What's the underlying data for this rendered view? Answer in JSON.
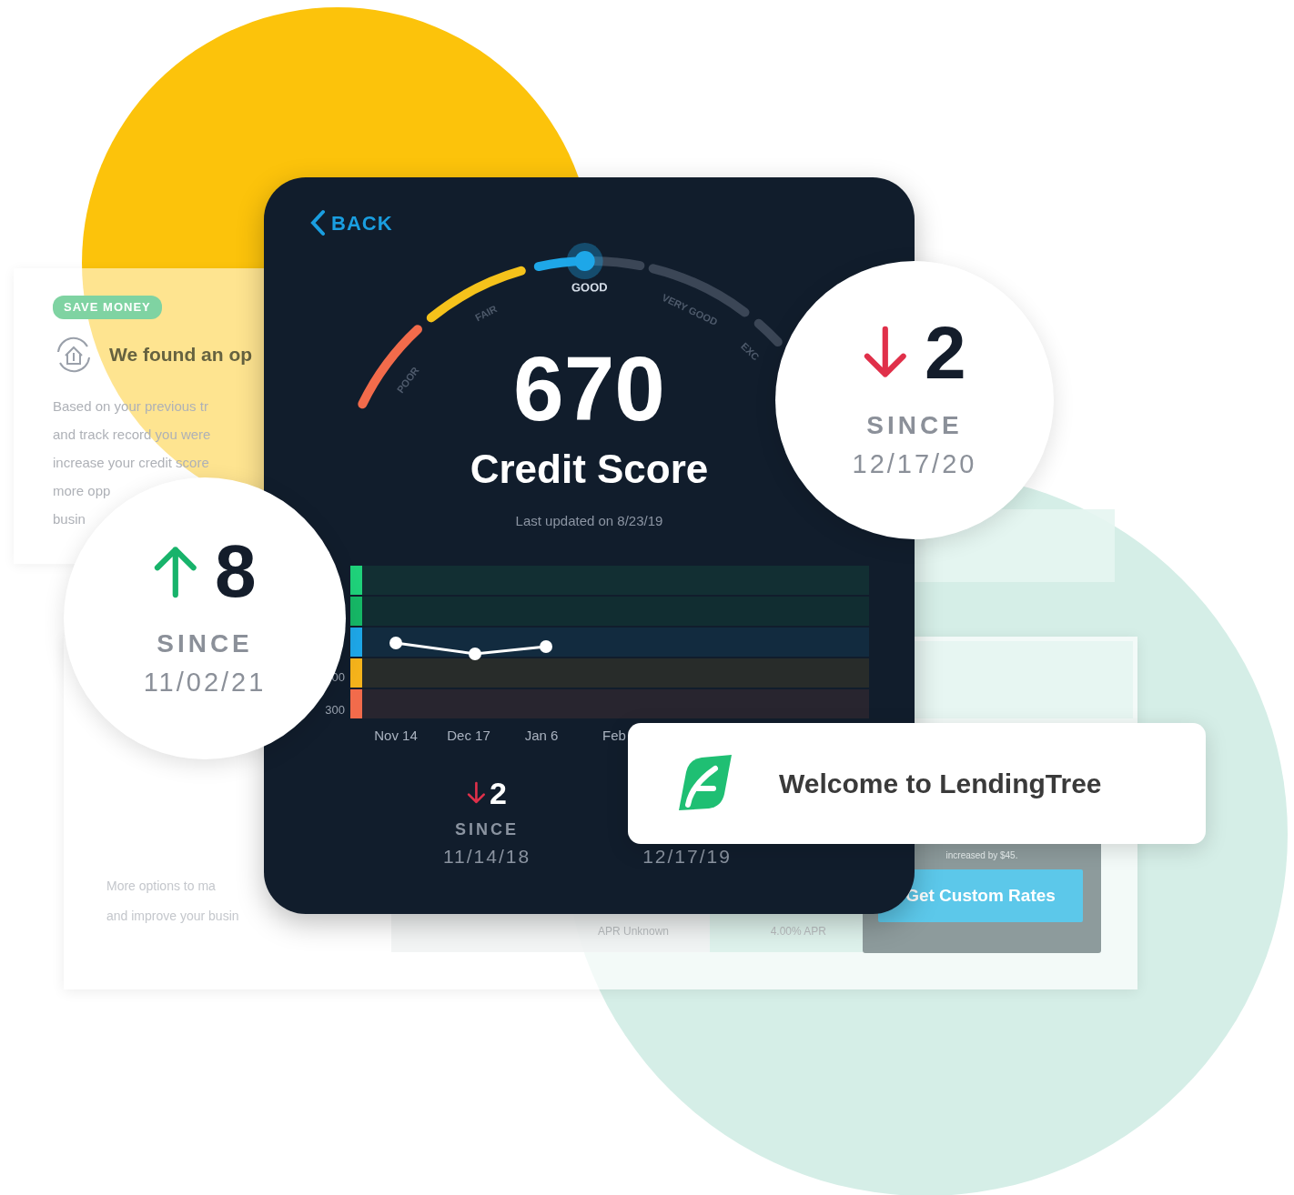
{
  "offer_card": {
    "badge": "SAVE MONEY",
    "title": "We found an op",
    "body": "Based on your previous tr\nand track record you were\nincrease your credit score\nmore opp\nbusin"
  },
  "rates_card": {
    "body": "More options to ma\nand improve your busin",
    "apr_labels": [
      "APR Unknown",
      "4.00% APR"
    ],
    "note": "increased by $45.",
    "button": "Get Custom Rates"
  },
  "score_card": {
    "back": "BACK",
    "gauge": [
      {
        "label": "POOR",
        "color": "#f26b4b",
        "selected": false
      },
      {
        "label": "FAIR",
        "color": "#f5c21b",
        "selected": false
      },
      {
        "label": "GOOD",
        "color": "#1ea7e8",
        "selected": true
      },
      {
        "label": "VERY GOOD",
        "color": "#3b4656",
        "selected": false
      },
      {
        "label": "EXC",
        "color": "#3b4656",
        "selected": false
      }
    ],
    "score": "670",
    "title": "Credit Score",
    "updated": "Last updated on 8/23/19",
    "chart": {
      "y_labels": [
        "00",
        "300"
      ],
      "x_labels": [
        "Nov 14",
        "Dec 17",
        "Jan 6",
        "Feb"
      ],
      "bands": [
        {
          "color": "#1fd17a"
        },
        {
          "color": "#16b866"
        },
        {
          "color": "#1ea7e8"
        },
        {
          "color": "#f5b31b"
        },
        {
          "color": "#f26b4b"
        }
      ]
    },
    "changes": [
      {
        "kind": "decrease",
        "value": "2",
        "since": "SINCE",
        "date": "11/14/18"
      },
      {
        "date": "12/17/19"
      }
    ]
  },
  "bubbles": [
    {
      "kind": "decrease",
      "value": "2",
      "since": "SINCE",
      "date": "12/17/20"
    },
    {
      "kind": "increase",
      "value": "8",
      "since": "SINCE",
      "date": "11/02/21"
    }
  ],
  "toast": {
    "text": "Welcome to LendingTree"
  }
}
